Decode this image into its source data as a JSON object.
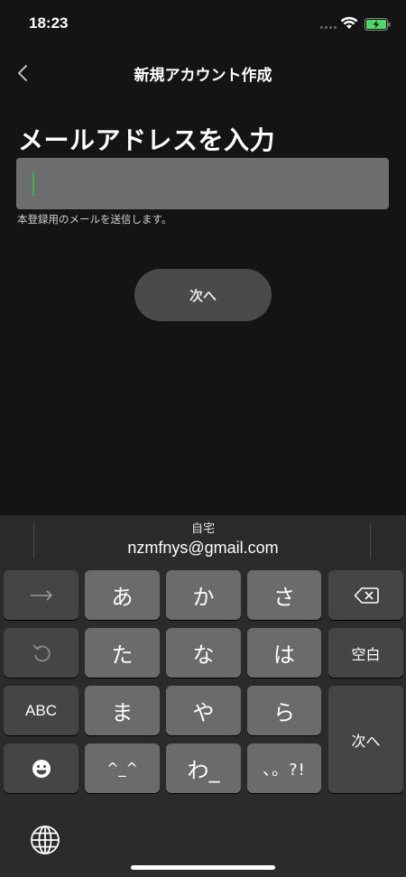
{
  "status": {
    "time": "18:23"
  },
  "nav": {
    "title": "新規アカウント作成"
  },
  "form": {
    "heading": "メールアドレスを入力",
    "email_value": "",
    "helper": "本登録用のメールを送信します。",
    "next_label": "次へ"
  },
  "keyboard": {
    "suggestion": {
      "label": "自宅",
      "value": "nzmfnys@gmail.com"
    },
    "keys": {
      "a": "あ",
      "ka": "か",
      "sa": "さ",
      "ta": "た",
      "na": "な",
      "ha": "は",
      "ma": "ま",
      "ya": "や",
      "ra": "ら",
      "kaomoji": "^_^",
      "wa": "わ_",
      "punct": "、。?!",
      "space": "空白",
      "abc": "ABC",
      "enter": "次へ"
    }
  },
  "icons": [
    "back-chevron-icon",
    "wifi-icon",
    "battery-icon",
    "arrow-right-icon",
    "undo-icon",
    "delete-icon",
    "emoji-icon",
    "globe-icon"
  ]
}
